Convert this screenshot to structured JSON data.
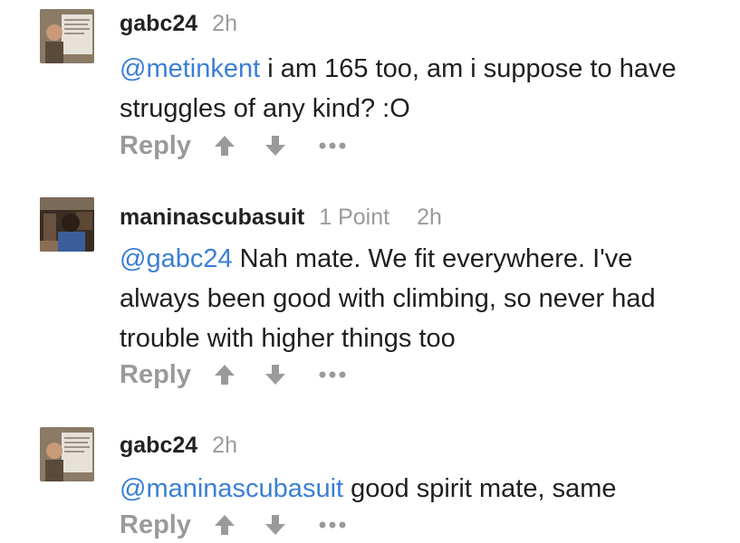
{
  "comments": [
    {
      "username": "gabc24",
      "points": "",
      "time": "2h",
      "mention": "@metinkent",
      "text": " i am 165 too, am i suppose to have struggles of any kind? :O",
      "reply_label": "Reply"
    },
    {
      "username": "maninascubasuit",
      "points": "1 Point",
      "time": "2h",
      "mention": "@gabc24",
      "text": " Nah mate. We fit everywhere. I've always been good with climbing, so never had trouble with higher things too",
      "reply_label": "Reply"
    },
    {
      "username": "gabc24",
      "points": "",
      "time": "2h",
      "mention": "@maninascubasuit",
      "text": " good spirit mate, same",
      "reply_label": "Reply"
    }
  ],
  "icons": {
    "upvote": "arrow-up-icon",
    "downvote": "arrow-down-icon",
    "more": "more-options-icon"
  },
  "colors": {
    "mention": "#3b7fd6",
    "meta": "#9a9a9a",
    "username": "#222222"
  }
}
